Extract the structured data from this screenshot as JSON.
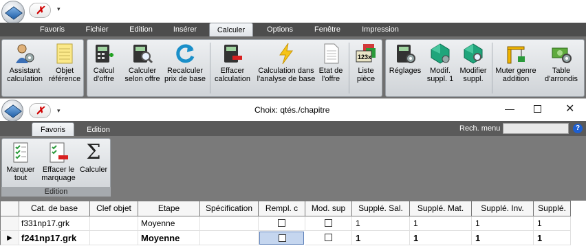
{
  "main": {
    "tabs": [
      "Favoris",
      "Fichier",
      "Edition",
      "Insérer",
      "Calculer",
      "Options",
      "Fenêtre",
      "Impression"
    ],
    "active_tab": "Calculer",
    "buttons": [
      {
        "l1": "Assistant",
        "l2": "calculation"
      },
      {
        "l1": "Objet",
        "l2": "référence"
      },
      {
        "l1": "Calcul",
        "l2": "d'offre"
      },
      {
        "l1": "Calculer",
        "l2": "selon offre"
      },
      {
        "l1": "Recalculer",
        "l2": "prix de base"
      },
      {
        "l1": "Effacer",
        "l2": "calculation"
      },
      {
        "l1": "Calculation dans",
        "l2": "l'analyse de base"
      },
      {
        "l1": "Etat de",
        "l2": "l'offre"
      },
      {
        "l1": "Liste",
        "l2": "pièce"
      },
      {
        "l1": "Réglages",
        "l2": ""
      },
      {
        "l1": "Modif.",
        "l2": "suppl. 1"
      },
      {
        "l1": "Modifier",
        "l2": "suppl."
      },
      {
        "l1": "Muter genre",
        "l2": "addition"
      },
      {
        "l1": "Table",
        "l2": "d'arrondis"
      }
    ],
    "liste_badge": "123x"
  },
  "dialog": {
    "title": "Choix: qtés./chapitre",
    "tabs": [
      "Favoris",
      "Edition"
    ],
    "active_tab": "Favoris",
    "search_label": "Rech. menu",
    "search_value": "",
    "help": "?",
    "buttons": [
      {
        "l1": "Marquer",
        "l2": "tout"
      },
      {
        "l1": "Effacer le",
        "l2": "marquage"
      },
      {
        "l1": "Calculer",
        "l2": ""
      }
    ],
    "group_label": "Edition",
    "sigma": "Σ"
  },
  "grid": {
    "columns": [
      "Cat. de base",
      "Clef objet",
      "Etape",
      "Spécification",
      "Rempl. c",
      "Mod. sup",
      "Supplé. Sal.",
      "Supplé. Mat.",
      "Supplé. Inv.",
      "Supplé."
    ],
    "rows": [
      {
        "cat": "f331np17.grk",
        "clef": "",
        "etape": "Moyenne",
        "spec": "",
        "rempl": false,
        "mod": false,
        "sal": "1",
        "mat": "1",
        "inv": "1",
        "supp": "1",
        "current": false
      },
      {
        "cat": "f241np17.grk",
        "clef": "",
        "etape": "Moyenne",
        "spec": "",
        "rempl": false,
        "mod": false,
        "sal": "1",
        "mat": "1",
        "inv": "1",
        "supp": "1",
        "current": true
      }
    ]
  }
}
